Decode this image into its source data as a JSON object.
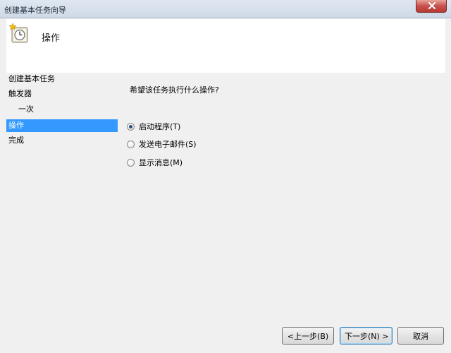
{
  "window": {
    "title": "创建基本任务向导"
  },
  "header": {
    "title": "操作",
    "icon": "task-scheduler-clock-icon"
  },
  "nav": {
    "items": [
      {
        "label": "创建基本任务",
        "indent": false,
        "selected": false
      },
      {
        "label": "触发器",
        "indent": false,
        "selected": false
      },
      {
        "label": "一次",
        "indent": true,
        "selected": false
      },
      {
        "label": "操作",
        "indent": false,
        "selected": true
      },
      {
        "label": "完成",
        "indent": false,
        "selected": false
      }
    ]
  },
  "main": {
    "question": "希望该任务执行什么操作?",
    "options": [
      {
        "label": "启动程序(T)",
        "checked": true
      },
      {
        "label": "发送电子邮件(S)",
        "checked": false
      },
      {
        "label": "显示消息(M)",
        "checked": false
      }
    ]
  },
  "buttons": {
    "back": "<上一步(B)",
    "next": "下一步(N) >",
    "cancel": "取消"
  },
  "colors": {
    "selection": "#3399ff",
    "close_button": "#c75050"
  }
}
